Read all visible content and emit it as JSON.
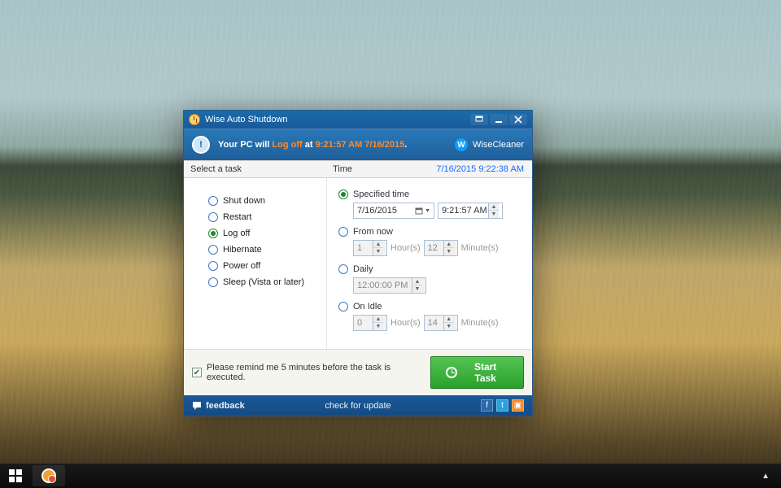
{
  "window": {
    "title": "Wise Auto Shutdown",
    "brand": "WiseCleaner"
  },
  "banner": {
    "prefix": "Your PC will ",
    "action": "Log off",
    "middle": " at ",
    "time": "9:21:57 AM 7/16/2015",
    "suffix": "."
  },
  "columns": {
    "task": "Select a task",
    "time": "Time",
    "timestamp": "7/16/2015 9:22:38 AM"
  },
  "tasks": {
    "shutdown": "Shut down",
    "restart": "Restart",
    "logoff": "Log off",
    "hibernate": "Hibernate",
    "poweroff": "Power off",
    "sleep": "Sleep (Vista or later)"
  },
  "timing": {
    "specified": {
      "label": "Specified time",
      "date": "7/16/2015",
      "time": "9:21:57 AM"
    },
    "fromnow": {
      "label": "From now",
      "hours": "1",
      "hours_unit": "Hour(s)",
      "minutes": "12",
      "minutes_unit": "Minute(s)"
    },
    "daily": {
      "label": "Daily",
      "time": "12:00:00 PM"
    },
    "onidle": {
      "label": "On Idle",
      "hours": "0",
      "hours_unit": "Hour(s)",
      "minutes": "14",
      "minutes_unit": "Minute(s)"
    }
  },
  "footer": {
    "reminder": "Please remind me 5 minutes before the task is executed.",
    "start": "Start Task",
    "feedback": "feedback",
    "update": "check for update"
  }
}
